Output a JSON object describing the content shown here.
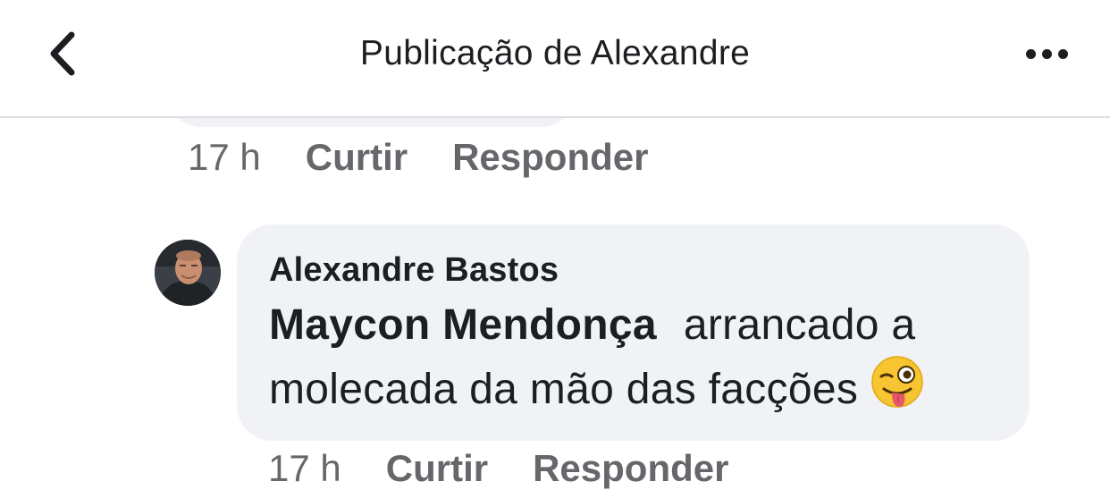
{
  "header": {
    "title": "Publicação de Alexandre"
  },
  "previous_comment": {
    "time": "17 h",
    "like_label": "Curtir",
    "reply_label": "Responder"
  },
  "reply": {
    "author": "Alexandre Bastos",
    "mention": "Maycon Mendonça",
    "text_part1": "arrancado a",
    "text_part2": "molecada da mão das facções",
    "emoji": "winking-face-with-tongue",
    "time": "17 h",
    "like_label": "Curtir",
    "reply_label": "Responder"
  },
  "icons": {
    "back": "chevron-left-icon",
    "more": "more-horizontal-icon"
  }
}
